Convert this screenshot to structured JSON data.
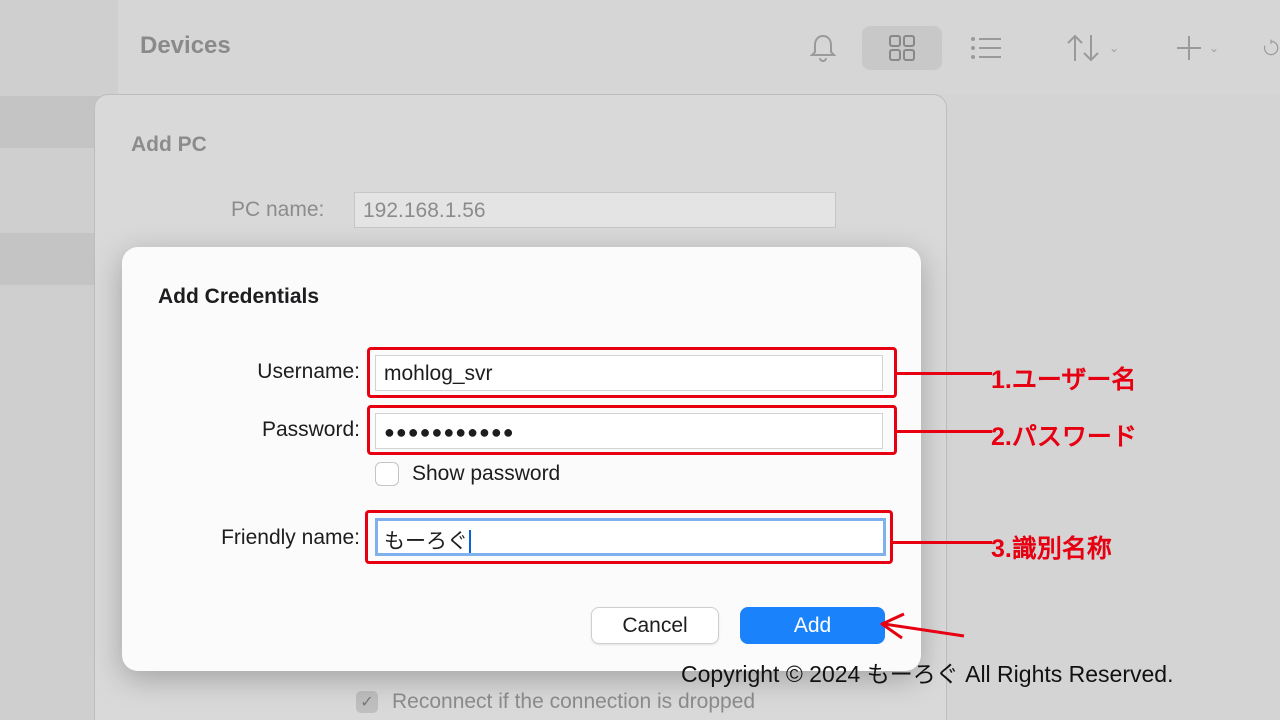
{
  "app": {
    "title": "Devices",
    "toolbar": {
      "icons": [
        "bell-icon",
        "grid-view-icon",
        "list-view-icon",
        "sort-icon",
        "add-icon",
        "refresh-icon"
      ],
      "chevron": "⌄"
    }
  },
  "add_pc_sheet": {
    "title": "Add PC",
    "pc_name_label": "PC name:",
    "pc_name_value": "192.168.1.56",
    "reconnect_label": "Reconnect if the connection is dropped",
    "reconnect_checked": true
  },
  "credentials_dialog": {
    "title": "Add Credentials",
    "username_label": "Username:",
    "username_value": "mohlog_svr",
    "password_label": "Password:",
    "password_value": "●●●●●●●●●●●",
    "show_password_label": "Show password",
    "show_password_checked": false,
    "friendly_name_label": "Friendly name:",
    "friendly_name_value": "もーろぐ",
    "cancel_label": "Cancel",
    "add_label": "Add",
    "accent_color": "#1a82fb"
  },
  "annotations": {
    "color": "#e60012",
    "username_note": "1.ユーザー名",
    "password_note": "2.パスワード",
    "friendly_note": "3.識別名称"
  },
  "watermark": {
    "copyright": "Copyright © 2024 もーろぐ All Rights Reserved."
  }
}
